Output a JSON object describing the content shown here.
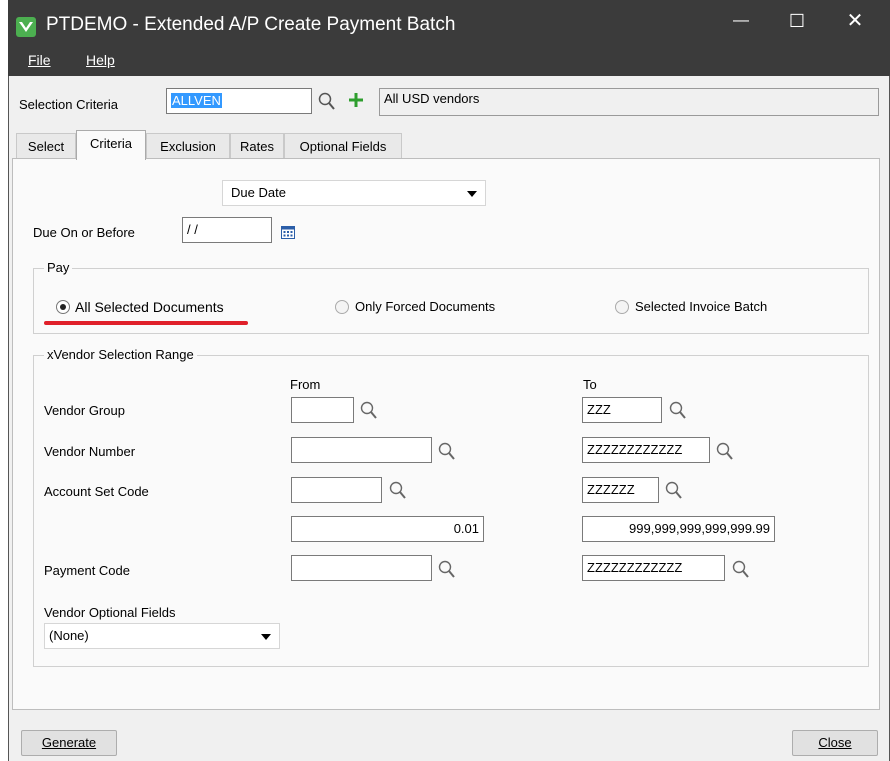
{
  "window": {
    "title": "PTDEMO - Extended A/P Create Payment Batch",
    "minimize": "—",
    "maximize": "☐",
    "close": "✕"
  },
  "menu": {
    "file": "File",
    "help": "Help"
  },
  "selection_criteria": {
    "label": "Selection Criteria",
    "code": "ALLVEN",
    "description": "All USD vendors"
  },
  "tabs": [
    "Select",
    "Criteria",
    "Exclusion",
    "Rates",
    "Optional Fields"
  ],
  "active_tab": "Criteria",
  "criteria": {
    "date_type": "Due Date",
    "due_label": "Due On or Before",
    "due_value": "/ /",
    "pay_group": "Pay",
    "pay_options": [
      "All Selected Documents",
      "Only Forced Documents",
      "Selected Invoice Batch"
    ],
    "pay_selected": "All Selected Documents",
    "highlight_color": "#e0202a",
    "vendor_group_title": "xVendor Selection Range",
    "from_header": "From",
    "to_header": "To",
    "rows": [
      {
        "label": "Vendor Group",
        "from": "",
        "to": "ZZZ"
      },
      {
        "label": "Vendor Number",
        "from": "",
        "to": "ZZZZZZZZZZZZ"
      },
      {
        "label": "Account Set Code",
        "from": "",
        "to": "ZZZZZZ"
      },
      {
        "label": "",
        "from": "0.01",
        "to": "999,999,999,999,999.99"
      },
      {
        "label": "Payment Code",
        "from": "",
        "to": "ZZZZZZZZZZZZ"
      }
    ],
    "vendor_optional_label": "Vendor Optional Fields",
    "vendor_optional_value": "(None)"
  },
  "buttons": {
    "generate": "Generate",
    "close": "Close"
  }
}
